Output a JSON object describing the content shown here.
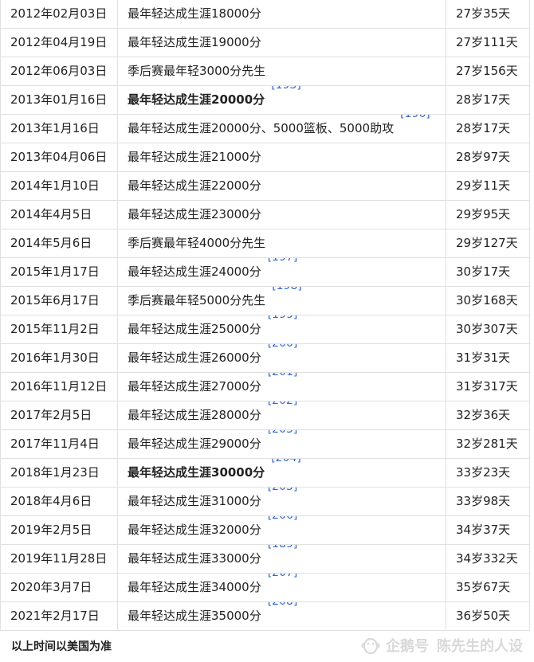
{
  "rows": [
    {
      "date": "2012年02月03日",
      "event": "最年轻达成生涯18000分",
      "bold": false,
      "ref": "",
      "age": "27岁35天"
    },
    {
      "date": "2012年04月19日",
      "event": "最年轻达成生涯19000分",
      "bold": false,
      "ref": "",
      "age": "27岁111天"
    },
    {
      "date": "2012年06月03日",
      "event": "季后赛最年轻3000分先生",
      "bold": false,
      "ref": "",
      "age": "27岁156天"
    },
    {
      "date": "2013年01月16日",
      "event": "最年轻达成生涯20000分",
      "bold": true,
      "ref": "[195]",
      "age": "28岁17天"
    },
    {
      "date": "2013年1月16日",
      "event": "最年轻达成生涯20000分、5000篮板、5000助攻",
      "bold": false,
      "ref": "[196]",
      "age": "28岁17天"
    },
    {
      "date": "2013年04月06日",
      "event": "最年轻达成生涯21000分",
      "bold": false,
      "ref": "",
      "age": "28岁97天"
    },
    {
      "date": "2014年1月10日",
      "event": "最年轻达成生涯22000分",
      "bold": false,
      "ref": "",
      "age": "29岁11天"
    },
    {
      "date": "2014年4月5日",
      "event": "最年轻达成生涯23000分",
      "bold": false,
      "ref": "",
      "age": "29岁95天"
    },
    {
      "date": "2014年5月6日",
      "event": "季后赛最年轻4000分先生",
      "bold": false,
      "ref": "",
      "age": "29岁127天"
    },
    {
      "date": "2015年1月17日",
      "event": "最年轻达成生涯24000分",
      "bold": false,
      "ref": "[197]",
      "age": "30岁17天"
    },
    {
      "date": "2015年6月17日",
      "event": "季后赛最年轻5000分先生",
      "bold": false,
      "ref": "[198]",
      "age": "30岁168天"
    },
    {
      "date": "2015年11月2日",
      "event": "最年轻达成生涯25000分",
      "bold": false,
      "ref": "[199]",
      "age": "30岁307天"
    },
    {
      "date": "2016年1月30日",
      "event": "最年轻达成生涯26000分",
      "bold": false,
      "ref": "[200]",
      "age": "31岁31天"
    },
    {
      "date": "2016年11月12日",
      "event": "最年轻达成生涯27000分",
      "bold": false,
      "ref": "[201]",
      "age": "31岁317天"
    },
    {
      "date": "2017年2月5日",
      "event": "最年轻达成生涯28000分",
      "bold": false,
      "ref": "[202]",
      "age": "32岁36天"
    },
    {
      "date": "2017年11月4日",
      "event": "最年轻达成生涯29000分",
      "bold": false,
      "ref": "[203]",
      "age": "32岁281天"
    },
    {
      "date": "2018年1月23日",
      "event": "最年轻达成生涯30000分",
      "bold": true,
      "ref": "[204]",
      "age": "33岁23天"
    },
    {
      "date": "2018年4月6日",
      "event": "最年轻达成生涯31000分",
      "bold": false,
      "ref": "[205]",
      "age": "33岁98天"
    },
    {
      "date": "2019年2月5日",
      "event": "最年轻达成生涯32000分",
      "bold": false,
      "ref": "[206]",
      "age": "34岁37天"
    },
    {
      "date": "2019年11月28日",
      "event": "最年轻达成生涯33000分",
      "bold": false,
      "ref": "[189]",
      "age": "34岁332天"
    },
    {
      "date": "2020年3月7日",
      "event": "最年轻达成生涯34000分",
      "bold": false,
      "ref": "[207]",
      "age": "35岁67天"
    },
    {
      "date": "2021年2月17日",
      "event": "最年轻达成生涯35000分",
      "bold": false,
      "ref": "[208]",
      "age": "36岁50天"
    }
  ],
  "footnote": "以上时间以美国为准",
  "watermark": {
    "brand": "企鹅号",
    "author": "陈先生的人设",
    "icon": "penguin-logo-icon"
  },
  "colors": {
    "link": "#3366cc",
    "border": "#e0e0e0",
    "text": "#222222",
    "watermark": "#d9d9d9"
  }
}
